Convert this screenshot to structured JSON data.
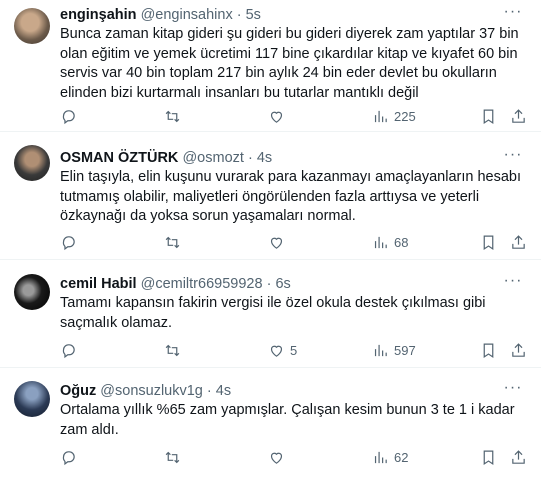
{
  "tweets": [
    {
      "name": "enginşahin",
      "handle": "@enginsahinx",
      "time": "5s",
      "text": "Bunca zaman kitap gideri şu gideri bu gideri diyerek zam yaptılar 37 bin olan eğitim ve yemek ücretimi 117 bine çıkardılar kitap ve kıyafet 60 bin servis var 40 bin  toplam 217 bin aylık 24 bin eder devlet bu okulların elinden bizi kurtarmalı insanları bu tutarlar mantıklı değil",
      "replies": "",
      "retweets": "",
      "likes": "",
      "views": "225",
      "avatar_color": "#6b5a4a"
    },
    {
      "name": "OSMAN ÖZTÜRK",
      "handle": "@osmozt",
      "time": "4s",
      "text": "Elin taşıyla, elin kuşunu vurarak para kazanmayı amaçlayanların hesabı tutmamış olabilir, maliyetleri öngörülenden fazla arttıysa ve yeterli özkaynağı da  yoksa sorun yaşamaları normal.",
      "replies": "",
      "retweets": "",
      "likes": "",
      "views": "68",
      "avatar_color": "#3a3a3a"
    },
    {
      "name": "cemil Habil",
      "handle": "@cemiltr66959928",
      "time": "6s",
      "text": "Tamamı kapansın fakirin vergisi ile özel okula destek çıkılması gibi saçmalık olamaz.",
      "replies": "",
      "retweets": "",
      "likes": "5",
      "views": "597",
      "avatar_color": "#1a1a1a"
    },
    {
      "name": "Oğuz",
      "handle": "@sonsuzlukv1g",
      "time": "4s",
      "text": "Ortalama yıllık %65 zam yapmışlar. Çalışan kesim bunun 3 te 1 i kadar zam aldı.",
      "replies": "",
      "retweets": "",
      "likes": "",
      "views": "62",
      "avatar_color": "#2b3a55"
    }
  ],
  "separator": "·",
  "icons": [
    "reply-icon",
    "retweet-icon",
    "like-icon",
    "views-icon",
    "bookmark-icon",
    "share-icon",
    "more-icon"
  ]
}
